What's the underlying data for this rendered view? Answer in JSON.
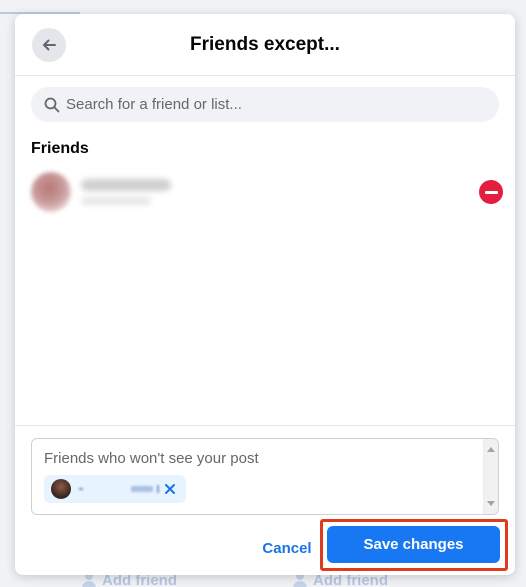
{
  "modal": {
    "title": "Friends except...",
    "back_icon": "arrow-left-icon"
  },
  "search": {
    "placeholder": "Search for a friend or list...",
    "value": "",
    "icon": "search-icon"
  },
  "friends_section": {
    "title": "Friends",
    "items": [
      {
        "name": "",
        "remove_icon": "minus-circle-icon"
      }
    ]
  },
  "excluded": {
    "label": "Friends who won't see your post",
    "chips": [
      {
        "name": "",
        "close_icon": "close-icon"
      }
    ]
  },
  "footer": {
    "cancel_label": "Cancel",
    "save_label": "Save changes"
  },
  "background": {
    "add_friend_label": "Add friend"
  },
  "colors": {
    "primary": "#1877f2",
    "link": "#1b74e4",
    "danger": "#e41e3f",
    "highlight": "#e0391b",
    "chip_bg": "#e7f3ff"
  }
}
